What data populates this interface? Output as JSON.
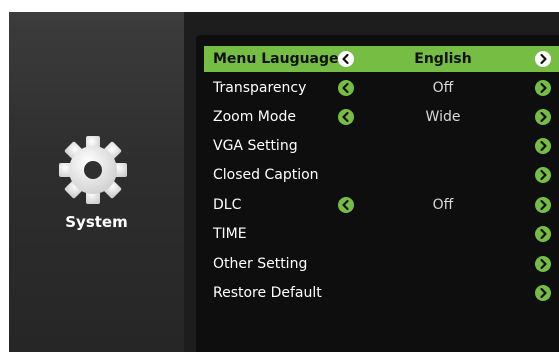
{
  "side": {
    "section_label": "System",
    "icon": "gear-icon"
  },
  "colors": {
    "accent": "#75bd43",
    "panel": "#0e0e0e",
    "selected_text": "#111111"
  },
  "menu": {
    "items": [
      {
        "label": "Menu Lauguage",
        "value": "English",
        "left_arrow": true,
        "right_arrow": true,
        "selected": true
      },
      {
        "label": "Transparency",
        "value": "Off",
        "left_arrow": true,
        "right_arrow": true,
        "selected": false
      },
      {
        "label": "Zoom Mode",
        "value": "Wide",
        "left_arrow": true,
        "right_arrow": true,
        "selected": false
      },
      {
        "label": "VGA Setting",
        "value": "",
        "left_arrow": false,
        "right_arrow": true,
        "selected": false
      },
      {
        "label": "Closed Caption",
        "value": "",
        "left_arrow": false,
        "right_arrow": true,
        "selected": false
      },
      {
        "label": "DLC",
        "value": "Off",
        "left_arrow": true,
        "right_arrow": true,
        "selected": false
      },
      {
        "label": "TIME",
        "value": "",
        "left_arrow": false,
        "right_arrow": true,
        "selected": false
      },
      {
        "label": "Other Setting",
        "value": "",
        "left_arrow": false,
        "right_arrow": true,
        "selected": false
      },
      {
        "label": "Restore Default",
        "value": "",
        "left_arrow": false,
        "right_arrow": true,
        "selected": false
      }
    ]
  }
}
